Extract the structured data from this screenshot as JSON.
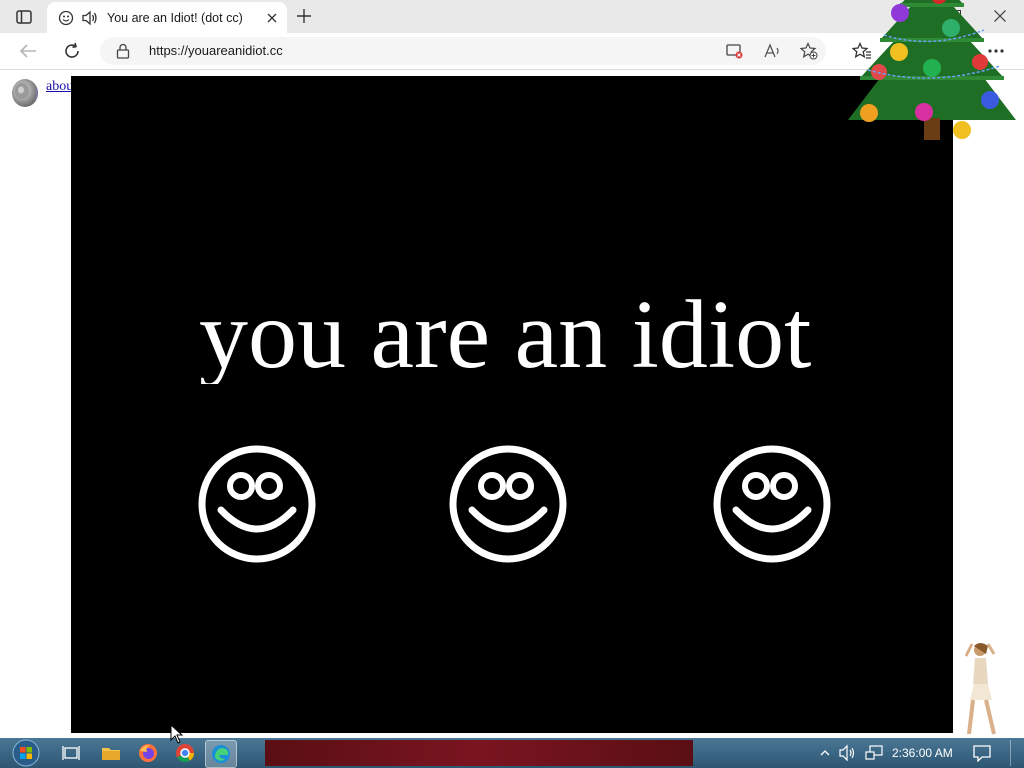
{
  "browser": {
    "tab": {
      "title": "You are an Idiot! (dot cc)"
    },
    "address_bar": {
      "url": "https://youareanidiot.cc"
    }
  },
  "page": {
    "about_link": "about flash",
    "headline": "you are an idiot",
    "smiley_count": 3
  },
  "taskbar": {
    "clock": "2:36:00 AM",
    "apps": [
      "task-view-icon",
      "file-explorer-icon",
      "firefox-icon",
      "chrome-icon",
      "edge-icon"
    ],
    "active_app": "edge-icon"
  },
  "icons": {
    "tab_actions": "tab-actions-icon",
    "favicon": "smiley-favicon-icon",
    "audio": "speaker-icon",
    "reading": "read-aloud-icon"
  },
  "colors": {
    "stage_background": "#000000",
    "headline_text": "#ffffff",
    "link": "#1a0dab",
    "tab_strip": "#e9e9e9"
  }
}
